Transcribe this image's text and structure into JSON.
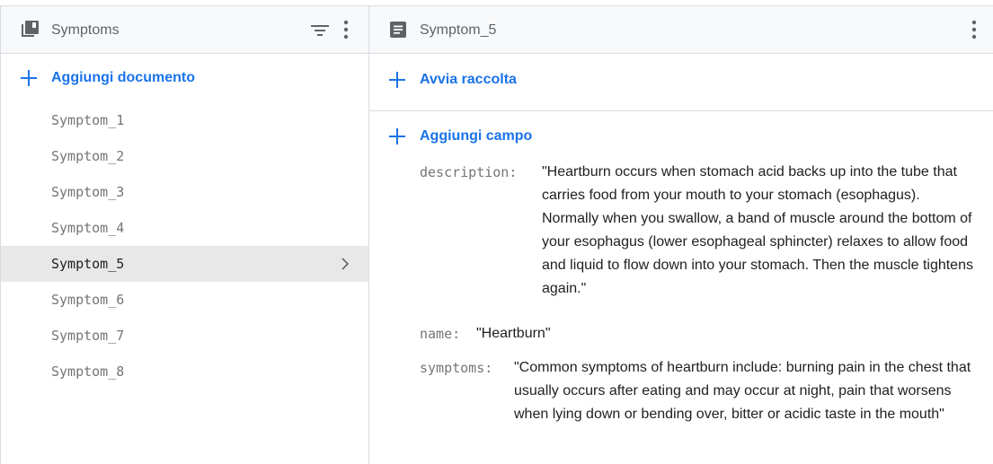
{
  "left_panel": {
    "title": "Symptoms",
    "icon": "collection-icon",
    "add_label": "Aggiungi documento",
    "documents": [
      "Symptom_1",
      "Symptom_2",
      "Symptom_3",
      "Symptom_4",
      "Symptom_5",
      "Symptom_6",
      "Symptom_7",
      "Symptom_8"
    ],
    "selected_index": 4
  },
  "right_panel": {
    "title": "Symptom_5",
    "icon": "document-icon",
    "start_collection_label": "Avvia raccolta",
    "add_field_label": "Aggiungi campo",
    "fields": {
      "description": {
        "key": "description:",
        "value": "\"Heartburn occurs when stomach acid backs up into the tube that carries food from your mouth to your stomach (esophagus). Normally when you swallow, a band of muscle around the bottom of your esophagus (lower esophageal sphincter) relaxes to allow food and liquid to flow down into your stomach. Then the muscle tightens again.\""
      },
      "name": {
        "key": "name:",
        "value": "\"Heartburn\""
      },
      "symptoms": {
        "key": "symptoms:",
        "value": "\"Common symptoms of heartburn include: burning pain in the chest that usually occurs after eating and may occur at night, pain that worsens when lying down or bending over, bitter or acidic taste in the mouth\""
      }
    }
  },
  "colors": {
    "accent": "#1a73e8",
    "border": "#dadce0",
    "selected_bg": "#e8e8e8",
    "muted_text": "#757575"
  }
}
